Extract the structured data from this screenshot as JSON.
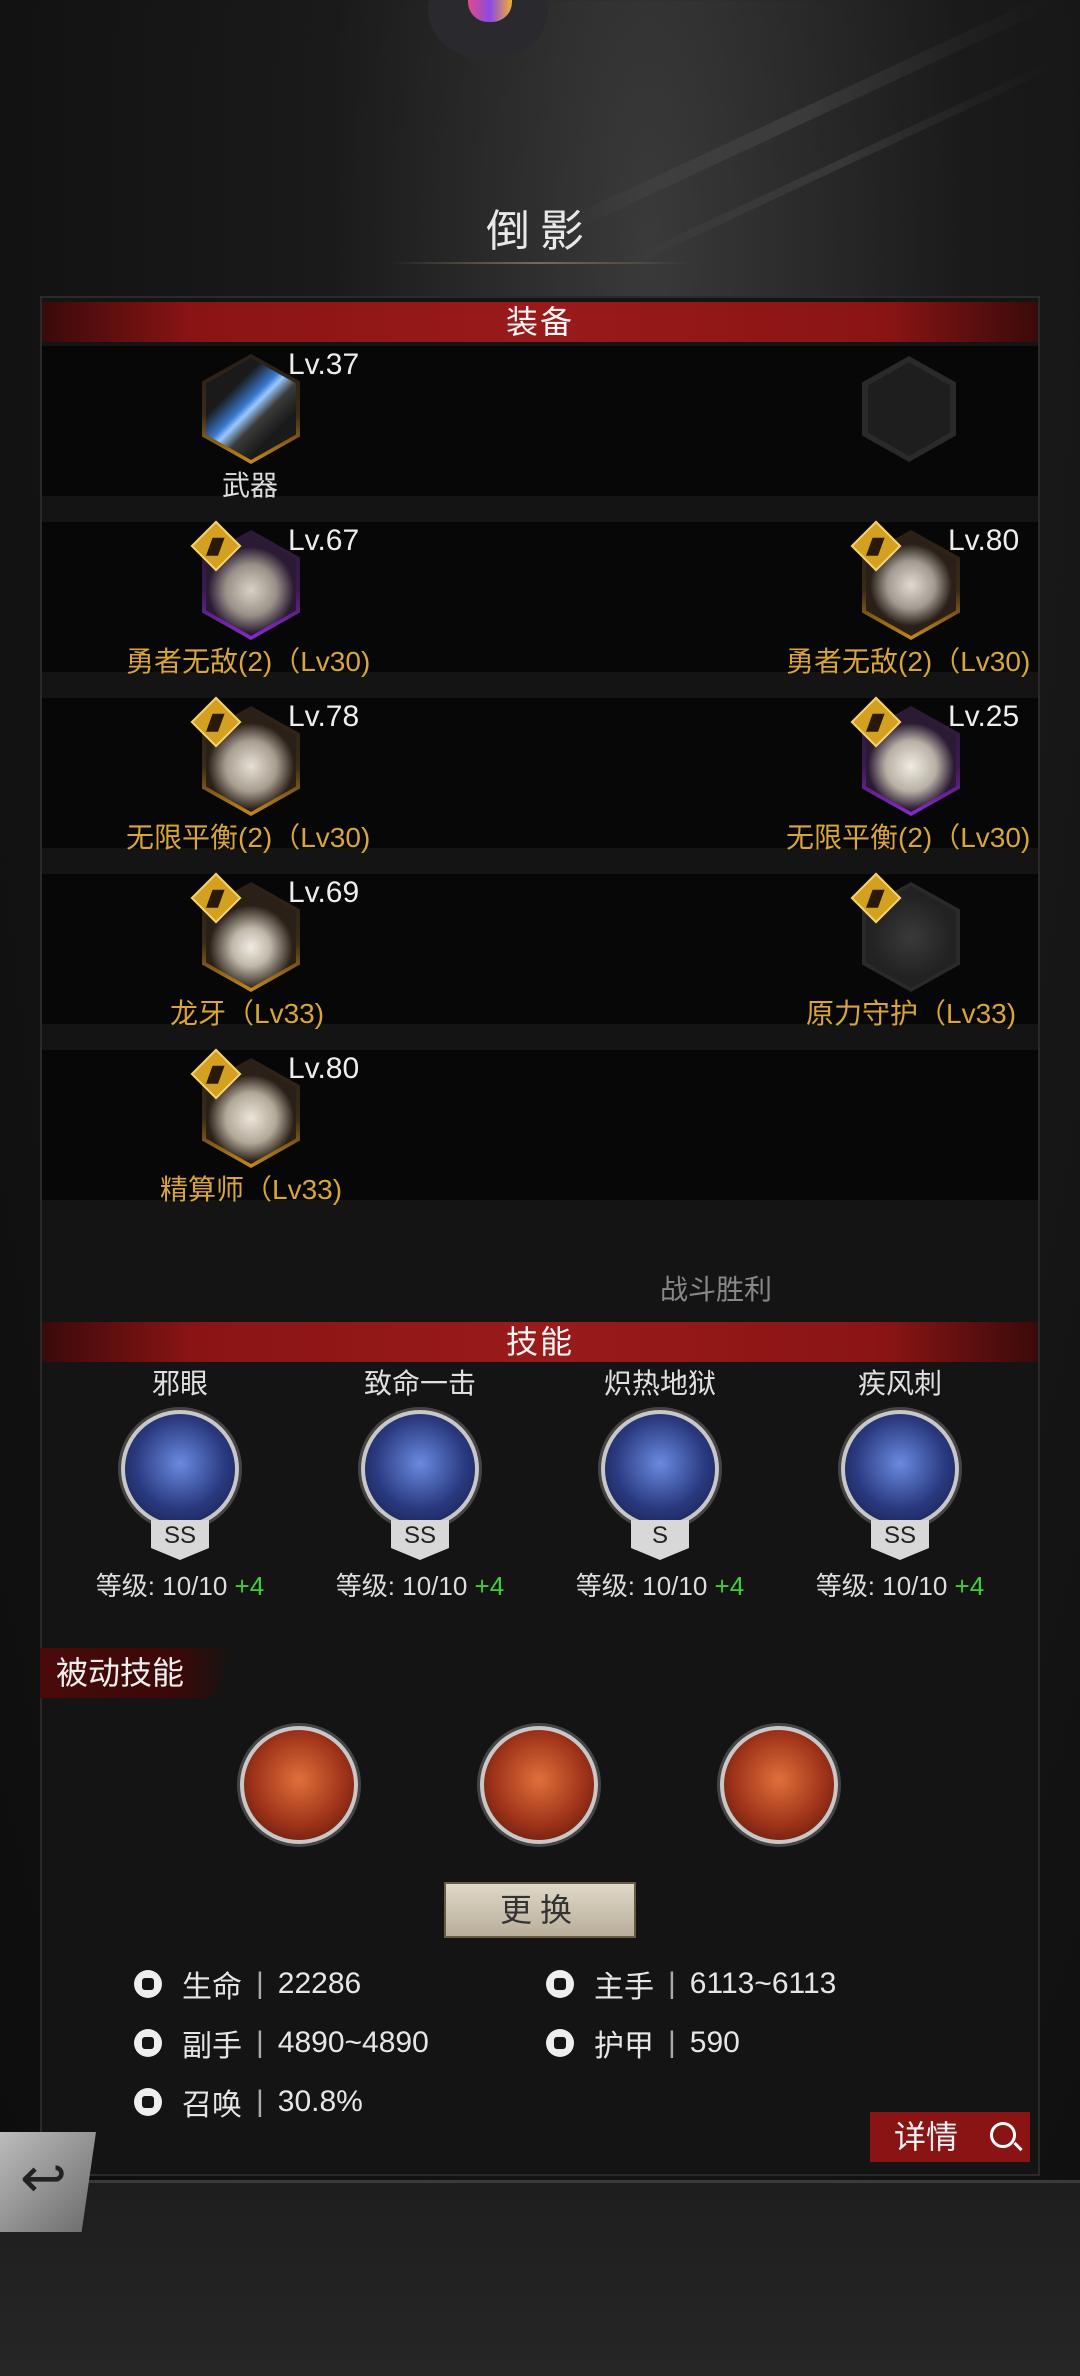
{
  "title": "倒影",
  "equipment": {
    "header": "装备",
    "rows": [
      {
        "left": {
          "level": "Lv.37",
          "label": "武器",
          "rarity": "gold",
          "set_badge": false,
          "label_color": "white"
        },
        "right": {
          "level": "",
          "label": "",
          "rarity": "empty",
          "set_badge": false,
          "icon": "shield-icon"
        }
      },
      {
        "left": {
          "level": "Lv.67",
          "label": "勇者无敌(2)（Lv30)",
          "rarity": "purple",
          "set_badge": true
        },
        "right": {
          "level": "Lv.80",
          "label": "勇者无敌(2)（Lv30)",
          "rarity": "gold",
          "set_badge": true
        }
      },
      {
        "left": {
          "level": "Lv.78",
          "label": "无限平衡(2)（Lv30)",
          "rarity": "gold",
          "set_badge": true
        },
        "right": {
          "level": "Lv.25",
          "label": "无限平衡(2)（Lv30)",
          "rarity": "purple",
          "set_badge": true
        }
      },
      {
        "left": {
          "level": "Lv.69",
          "label": "龙牙（Lv33)",
          "rarity": "gold",
          "set_badge": true
        },
        "right": {
          "level": "",
          "label": "原力守护（Lv33)",
          "rarity": "empty",
          "set_badge": true
        }
      },
      {
        "left": {
          "level": "Lv.80",
          "label": "精算师（Lv33)",
          "rarity": "gold",
          "set_badge": true
        }
      }
    ]
  },
  "victory_text": "战斗胜利",
  "skills": {
    "header": "技能",
    "active": [
      {
        "name": "邪眼",
        "grade": "SS",
        "level_label": "等级: 10/10",
        "bonus": "+4",
        "icon": "evil-eye-icon"
      },
      {
        "name": "致命一击",
        "grade": "SS",
        "level_label": "等级: 10/10",
        "bonus": "+4",
        "icon": "critical-strike-icon"
      },
      {
        "name": "炽热地狱",
        "grade": "S",
        "level_label": "等级: 10/10",
        "bonus": "+4",
        "icon": "inferno-icon"
      },
      {
        "name": "疾风刺",
        "grade": "SS",
        "level_label": "等级: 10/10",
        "bonus": "+4",
        "icon": "gale-thrust-icon"
      }
    ],
    "passive_header": "被动技能",
    "passive": [
      {
        "icon": "passive-shield-swirl-icon"
      },
      {
        "icon": "passive-elements-icon"
      },
      {
        "icon": "passive-sword-icon"
      }
    ],
    "change_button": "更换"
  },
  "stats": [
    {
      "icon": "heart-icon",
      "label": "生命",
      "value": "22286"
    },
    {
      "icon": "main-hand-icon",
      "label": "主手",
      "value": "6113~6113"
    },
    {
      "icon": "off-hand-icon",
      "label": "副手",
      "value": "4890~4890"
    },
    {
      "icon": "armor-icon",
      "label": "护甲",
      "value": "590"
    },
    {
      "icon": "summon-icon",
      "label": "召唤",
      "value": "30.8%"
    }
  ],
  "detail_button": "详情",
  "colors": {
    "accent_red": "#8a1414",
    "set_gold": "#d9a53a",
    "bonus_green": "#3ccf3c"
  }
}
